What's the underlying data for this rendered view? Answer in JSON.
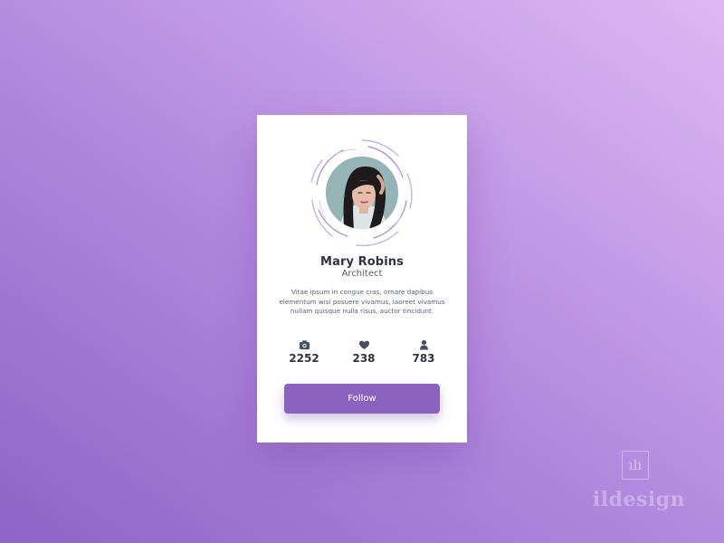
{
  "profile": {
    "name": "Mary Robins",
    "role": "Architect",
    "bio": "Vitae ipsum in congue cras, ornare dapibus elementum wisi posuere vivamus, laoreet vivamus nullam quisque nulla risus, auctor tincidunt."
  },
  "stats": [
    {
      "icon": "camera-icon",
      "value": "2252"
    },
    {
      "icon": "heart-icon",
      "value": "238"
    },
    {
      "icon": "user-icon",
      "value": "783"
    }
  ],
  "actions": {
    "follow_label": "Follow"
  },
  "watermark": {
    "mark": "ılı",
    "text": "ildesign"
  },
  "colors": {
    "accent": "#8b62c0",
    "text_dark": "#2f3442",
    "text_muted": "#5b6070",
    "card": "#ffffff"
  }
}
